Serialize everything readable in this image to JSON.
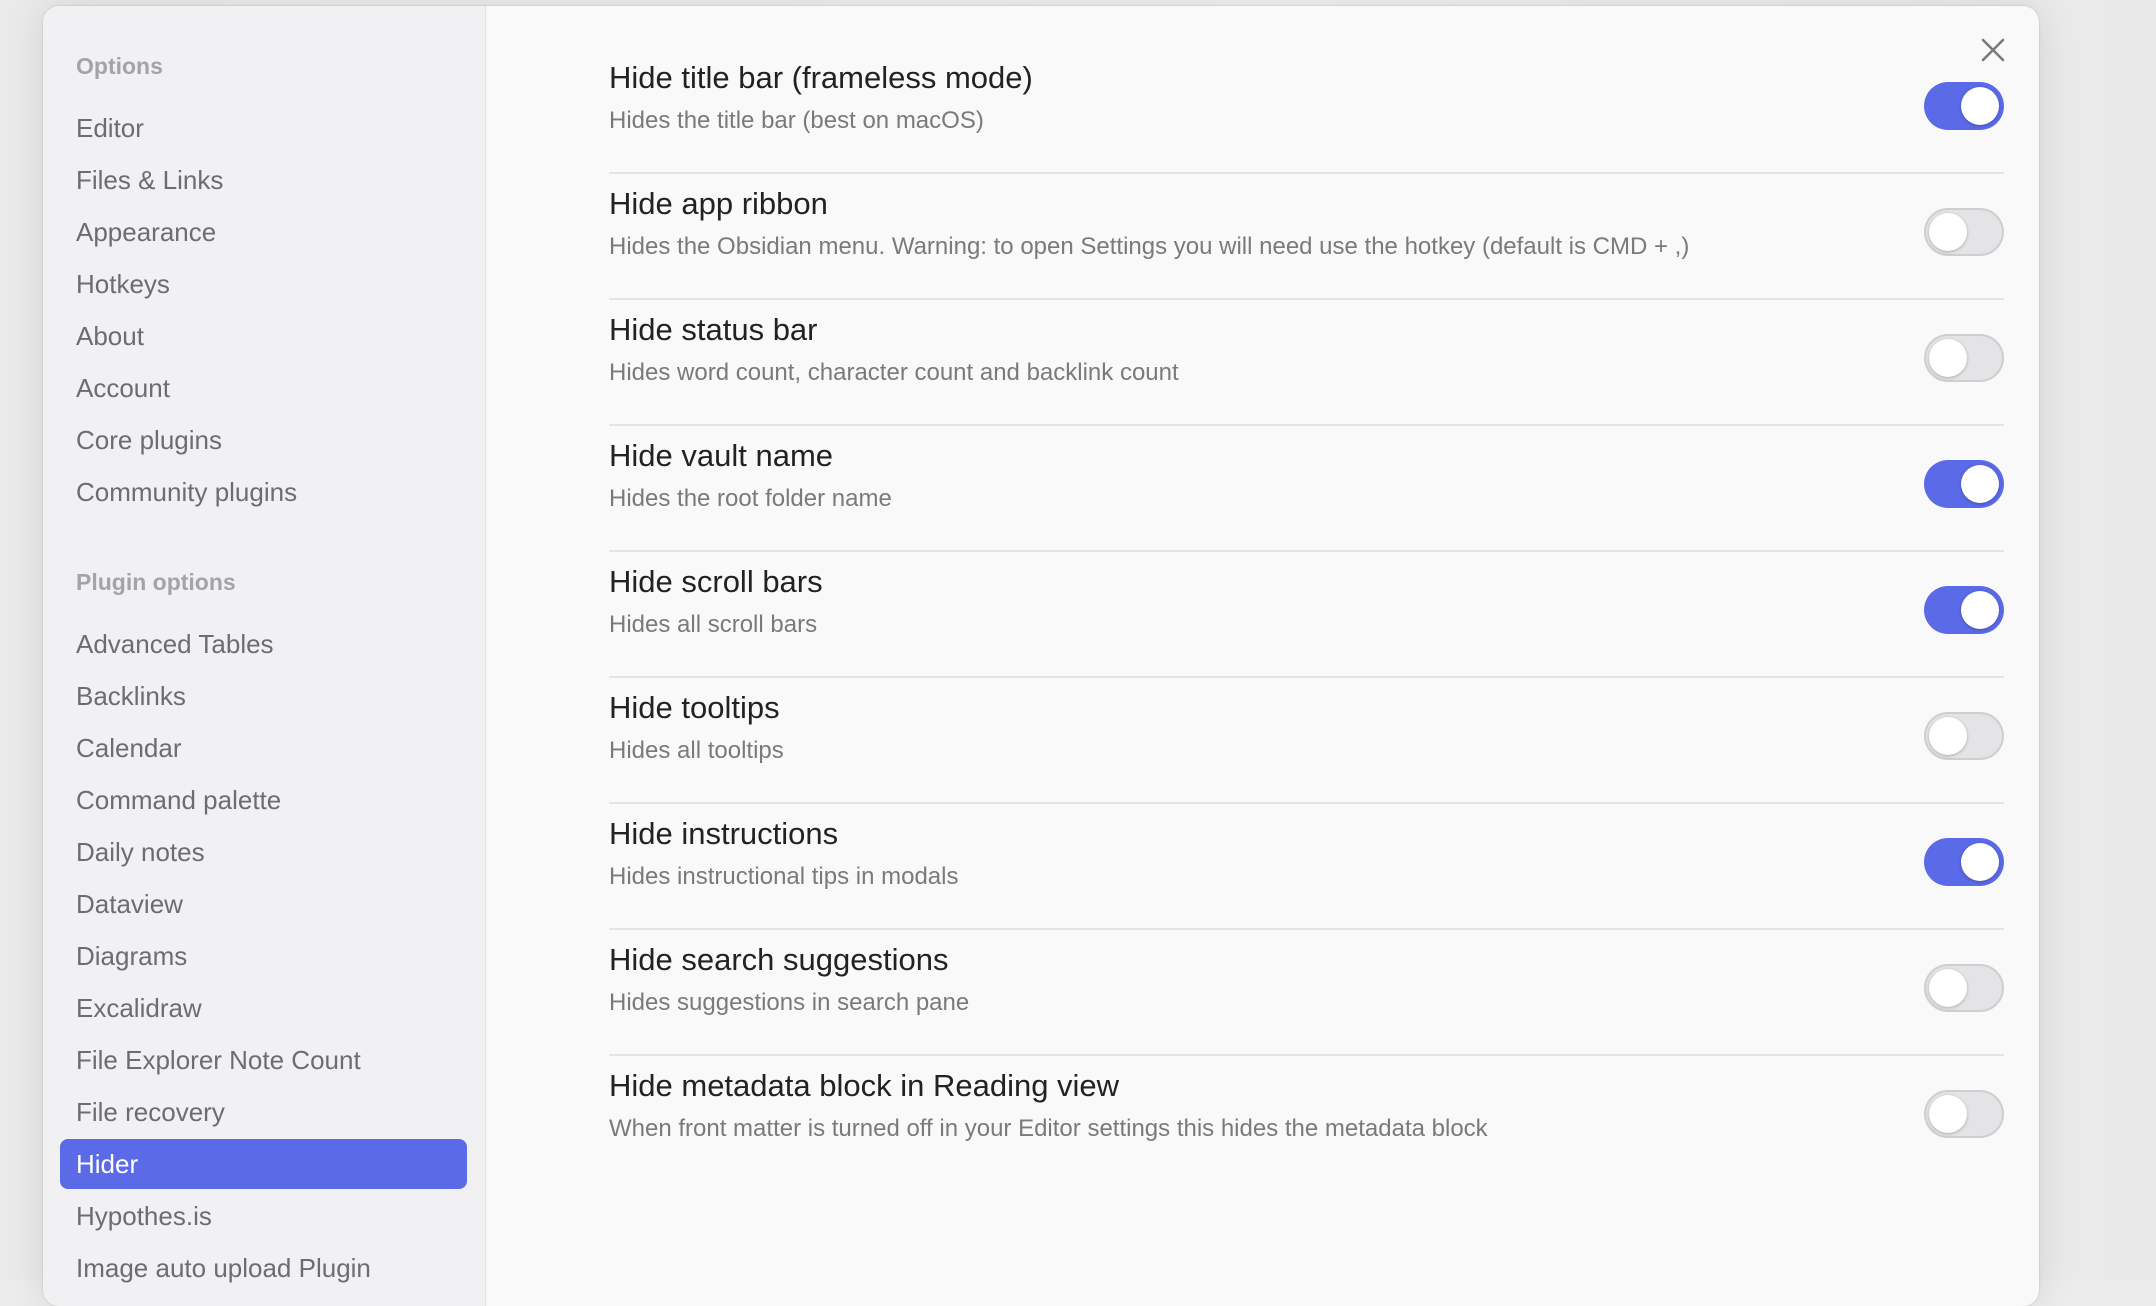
{
  "sidebar": {
    "options_header": "Options",
    "options": [
      {
        "label": "Editor"
      },
      {
        "label": "Files & Links"
      },
      {
        "label": "Appearance"
      },
      {
        "label": "Hotkeys"
      },
      {
        "label": "About"
      },
      {
        "label": "Account"
      },
      {
        "label": "Core plugins"
      },
      {
        "label": "Community plugins"
      }
    ],
    "plugin_header": "Plugin options",
    "plugins": [
      {
        "label": "Advanced Tables"
      },
      {
        "label": "Backlinks"
      },
      {
        "label": "Calendar"
      },
      {
        "label": "Command palette"
      },
      {
        "label": "Daily notes"
      },
      {
        "label": "Dataview"
      },
      {
        "label": "Diagrams"
      },
      {
        "label": "Excalidraw"
      },
      {
        "label": "File Explorer Note Count"
      },
      {
        "label": "File recovery"
      },
      {
        "label": "Hider",
        "active": true
      },
      {
        "label": "Hypothes.is"
      },
      {
        "label": "Image auto upload Plugin"
      }
    ]
  },
  "close_icon": "close-icon",
  "accent_color": "#5b6ae6",
  "settings": [
    {
      "name": "Hide title bar (frameless mode)",
      "desc": "Hides the title bar (best on macOS)",
      "enabled": true
    },
    {
      "name": "Hide app ribbon",
      "desc": "Hides the Obsidian menu. Warning: to open Settings you will need use the hotkey (default is CMD + ,)",
      "enabled": false
    },
    {
      "name": "Hide status bar",
      "desc": "Hides word count, character count and backlink count",
      "enabled": false
    },
    {
      "name": "Hide vault name",
      "desc": "Hides the root folder name",
      "enabled": true
    },
    {
      "name": "Hide scroll bars",
      "desc": "Hides all scroll bars",
      "enabled": true
    },
    {
      "name": "Hide tooltips",
      "desc": "Hides all tooltips",
      "enabled": false
    },
    {
      "name": "Hide instructions",
      "desc": "Hides instructional tips in modals",
      "enabled": true
    },
    {
      "name": "Hide search suggestions",
      "desc": "Hides suggestions in search pane",
      "enabled": false
    },
    {
      "name": "Hide metadata block in Reading view",
      "desc": "When front matter is turned off in your Editor settings this hides the metadata block",
      "enabled": false
    }
  ]
}
